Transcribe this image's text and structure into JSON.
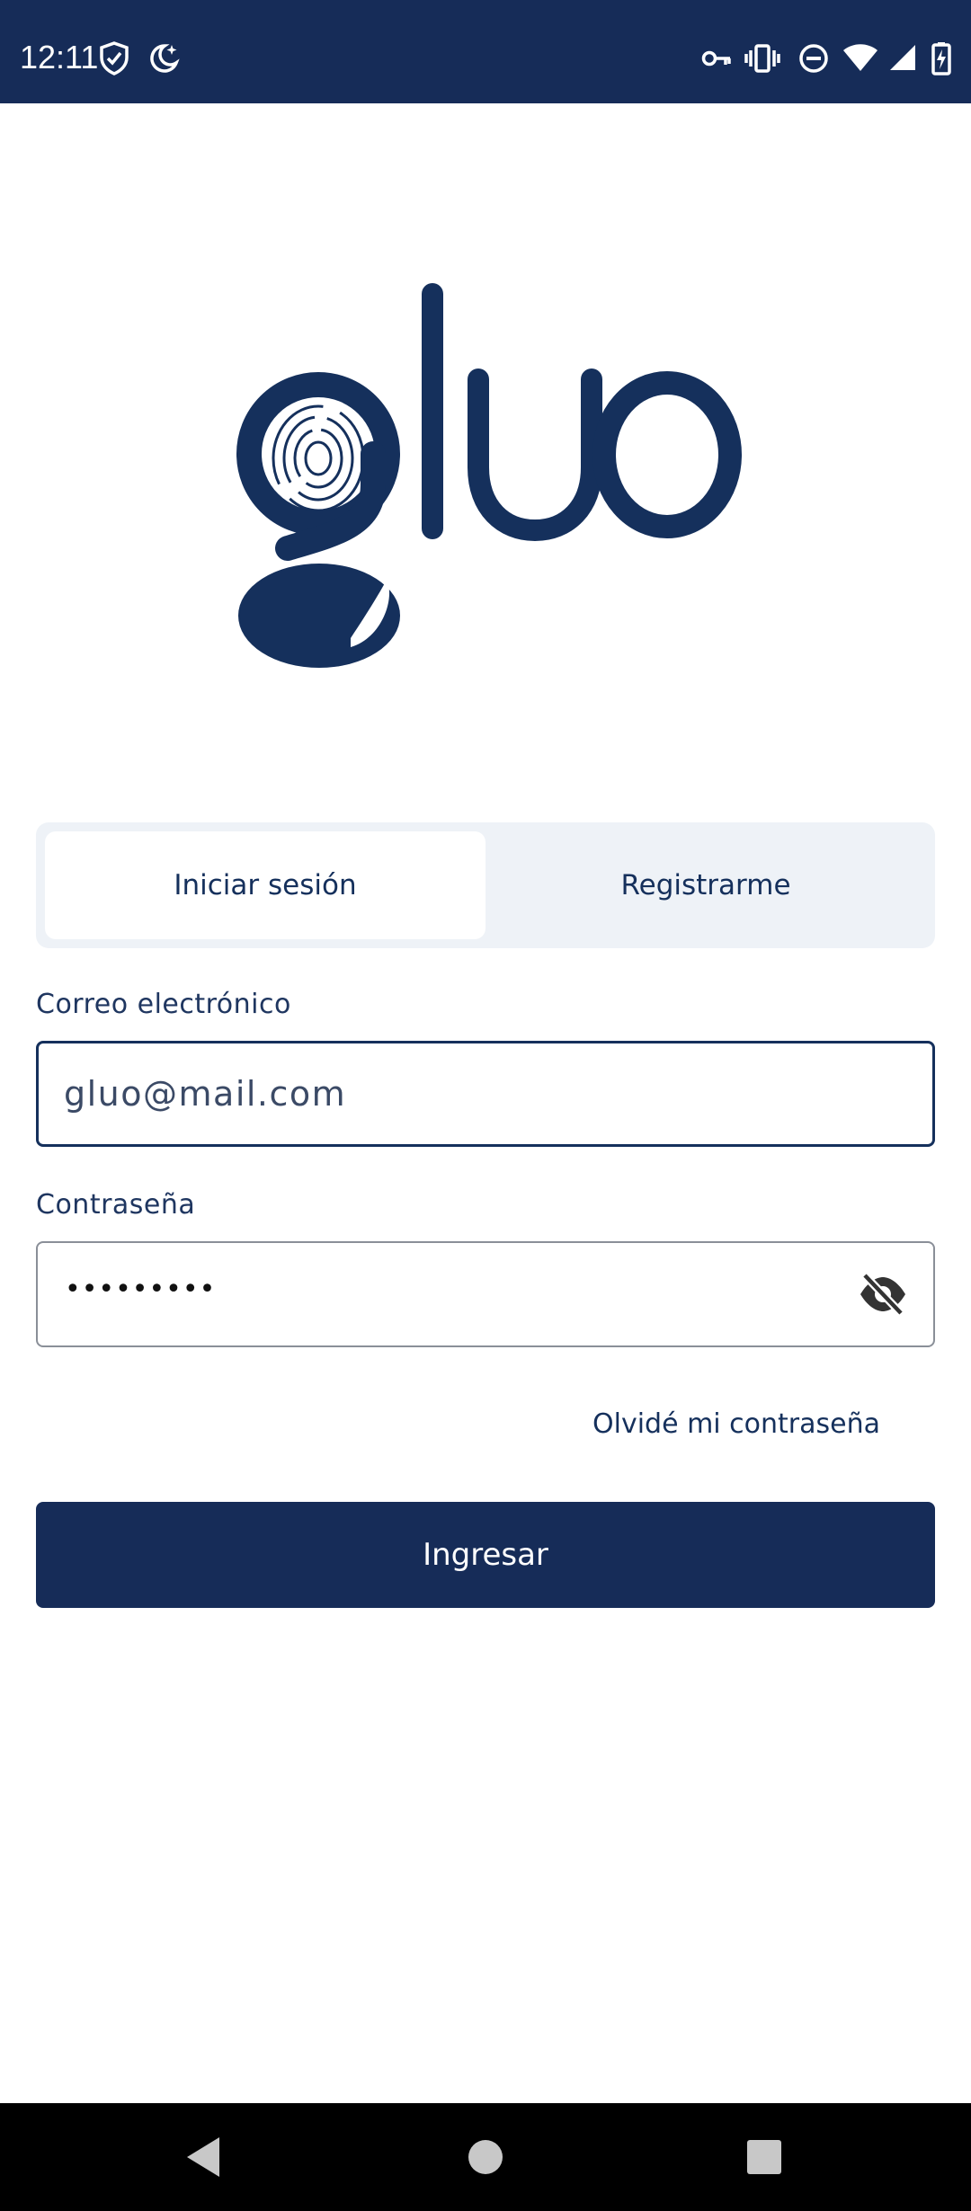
{
  "status_bar": {
    "time": "12:11",
    "icons_left": [
      "shield-check-icon",
      "moon-icon"
    ],
    "icons_right": [
      "vpn-key-icon",
      "vibrate-icon",
      "do-not-disturb-icon",
      "wifi-icon",
      "signal-icon",
      "battery-charging-icon"
    ],
    "background": "#162c58"
  },
  "logo": {
    "text": "gluo",
    "color": "#15305c"
  },
  "tabs": [
    {
      "label": "Iniciar sesión",
      "active": true
    },
    {
      "label": "Registrarme",
      "active": false
    }
  ],
  "email": {
    "label": "Correo electrónico",
    "placeholder": "gluo@mail.com",
    "value": ""
  },
  "password": {
    "label": "Contraseña",
    "masked_value": "•••••••••",
    "toggle_icon": "eye-off-icon"
  },
  "forgot_password": "Olvidé mi contraseña",
  "submit_label": "Ingresar",
  "nav": [
    "back-icon",
    "home-icon",
    "recents-icon"
  ],
  "colors": {
    "brand": "#162c58",
    "tab_bg": "#eef2f7"
  }
}
